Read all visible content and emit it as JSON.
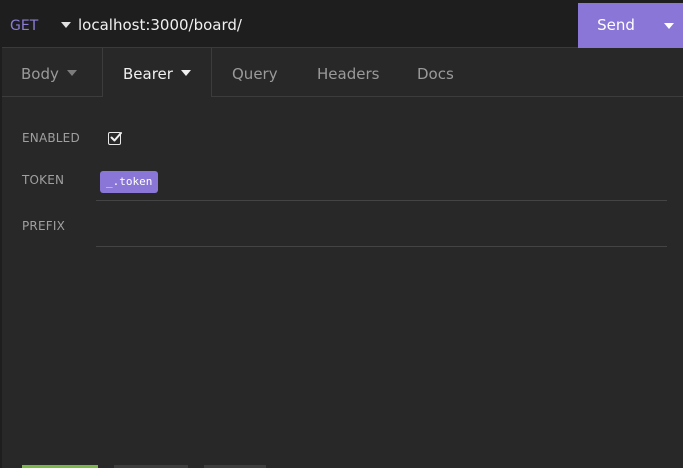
{
  "urlbar": {
    "method": "GET",
    "url": "localhost:3000/board/",
    "send_label": "Send"
  },
  "tabs": [
    {
      "label": "Body",
      "has_caret": true
    },
    {
      "label": "Bearer",
      "has_caret": true,
      "active": true
    },
    {
      "label": "Query"
    },
    {
      "label": "Headers"
    },
    {
      "label": "Docs"
    }
  ],
  "form": {
    "enabled_label": "ENABLED",
    "enabled_checked": true,
    "token_label": "TOKEN",
    "token_value": "_.token",
    "prefix_label": "PREFIX",
    "prefix_value": ""
  },
  "colors": {
    "accent": "#8a76d6",
    "method": "#8d7dd6",
    "background": "#282828",
    "status_green": "#7ab648"
  }
}
